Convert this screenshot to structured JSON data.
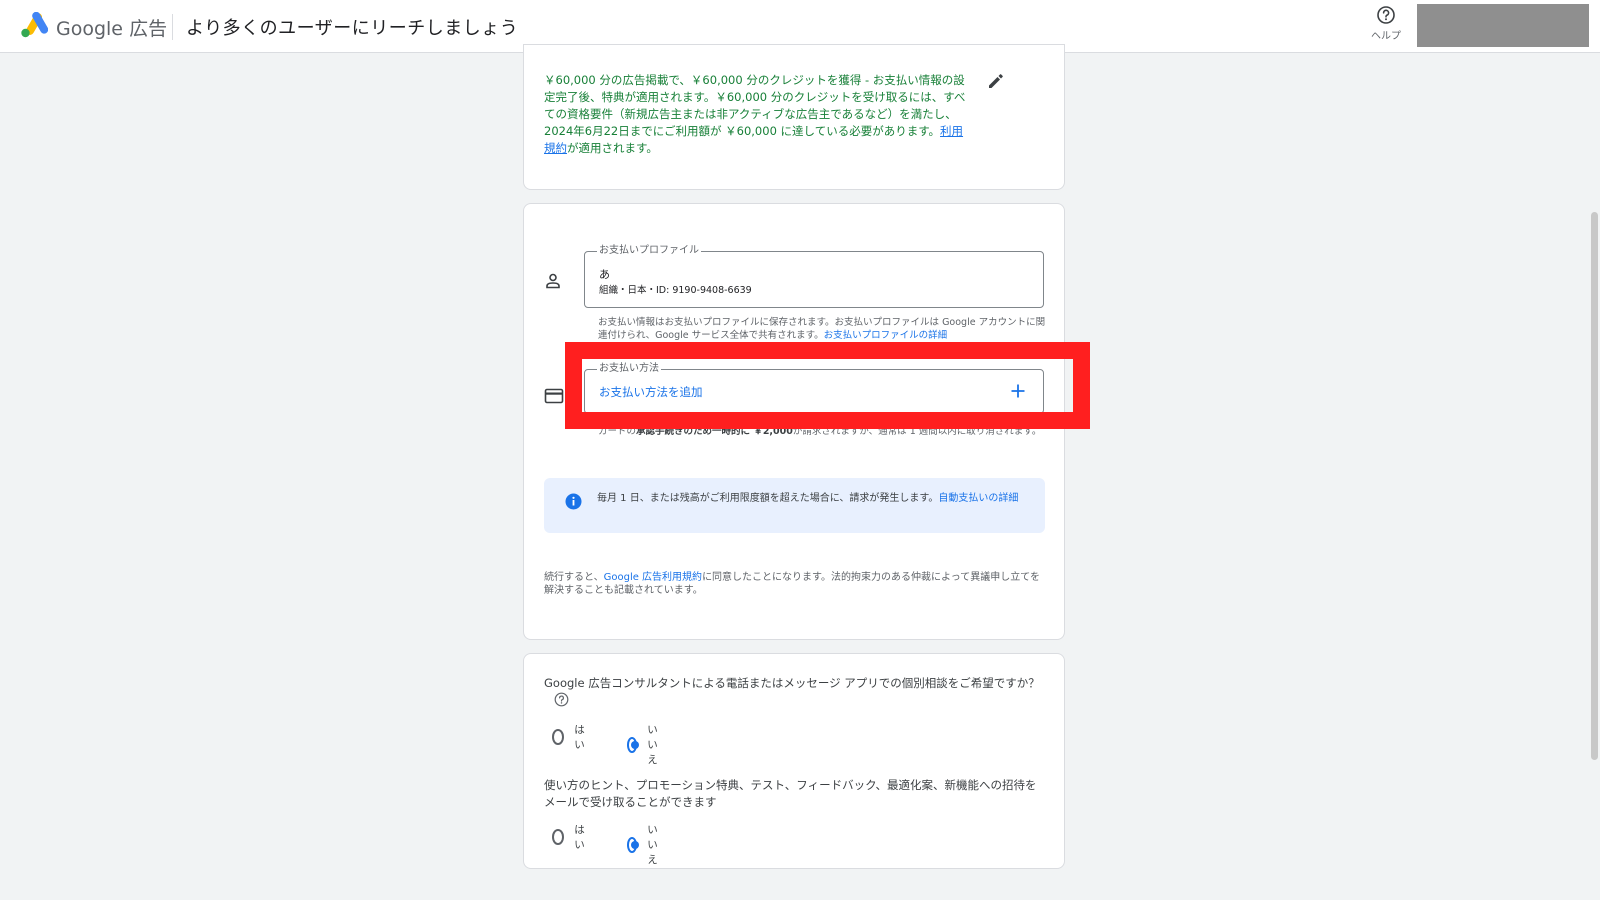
{
  "header": {
    "brand_google": "Google",
    "brand_ads": "広告",
    "title": "より多くのユーザーにリーチしましょう",
    "help_label": "ヘルプ"
  },
  "promo": {
    "text": "￥60,000 分の広告掲載で、￥60,000 分のクレジットを獲得 - お支払い情報の設定完了後、特典が適用されます。￥60,000 分のクレジットを受け取るには、すべての資格要件（新規広告主または非アクティブな広告主であるなど）を満たし、2024年6月22日までにご利用額が ￥60,000 に達している必要があります。",
    "link": "利用規約",
    "suffix": "が適用されます。"
  },
  "payment": {
    "profile_legend": "お支払いプロファイル",
    "profile_name": "あ",
    "profile_detail": "組織・日本・ID: 9190-9408-6639",
    "profile_help": "お支払い情報はお支払いプロファイルに保存されます。お支払いプロファイルは Google アカウントに関連付けられ、Google サービス全体で共有されます。",
    "profile_help_link": "お支払いプロファイルの詳細",
    "method_legend": "お支払い方法",
    "add_method": "お支払い方法を追加",
    "note_prefix": "カードの",
    "note_bold": "承認手続きのため一時的に ￥2,000",
    "note_suffix": "が請求されますが、通常は 1 週間以内に取り消されます。",
    "info_text": "毎月 1 日、または残高がご利用限度額を超えた場合に、請求が発生します。",
    "info_link": "自動支払いの詳細",
    "terms_prefix": "続行すると、",
    "terms_link": "Google 広告利用規約",
    "terms_suffix": "に同意したことになります。法的拘束力のある仲裁によって異議申し立てを解決することも記載されています。"
  },
  "consult": {
    "q1": "Google 広告コンサルタントによる電話またはメッセージ アプリでの個別相談をご希望ですか？",
    "q2": "使い方のヒント、プロモーション特典、テスト、フィードバック、最適化案、新機能への招待をメールで受け取ることができます",
    "yes": "はい",
    "no": "いいえ",
    "q1_selected": "いいえ",
    "q2_selected": "いいえ"
  },
  "colors": {
    "accent": "#1a73e8",
    "promo_green": "#188038",
    "highlight_red": "#ff1f1f"
  },
  "icons": [
    "google-ads-logo",
    "help-icon",
    "edit-icon",
    "person-icon",
    "credit-card-icon",
    "plus-icon",
    "info-icon",
    "question-icon"
  ]
}
